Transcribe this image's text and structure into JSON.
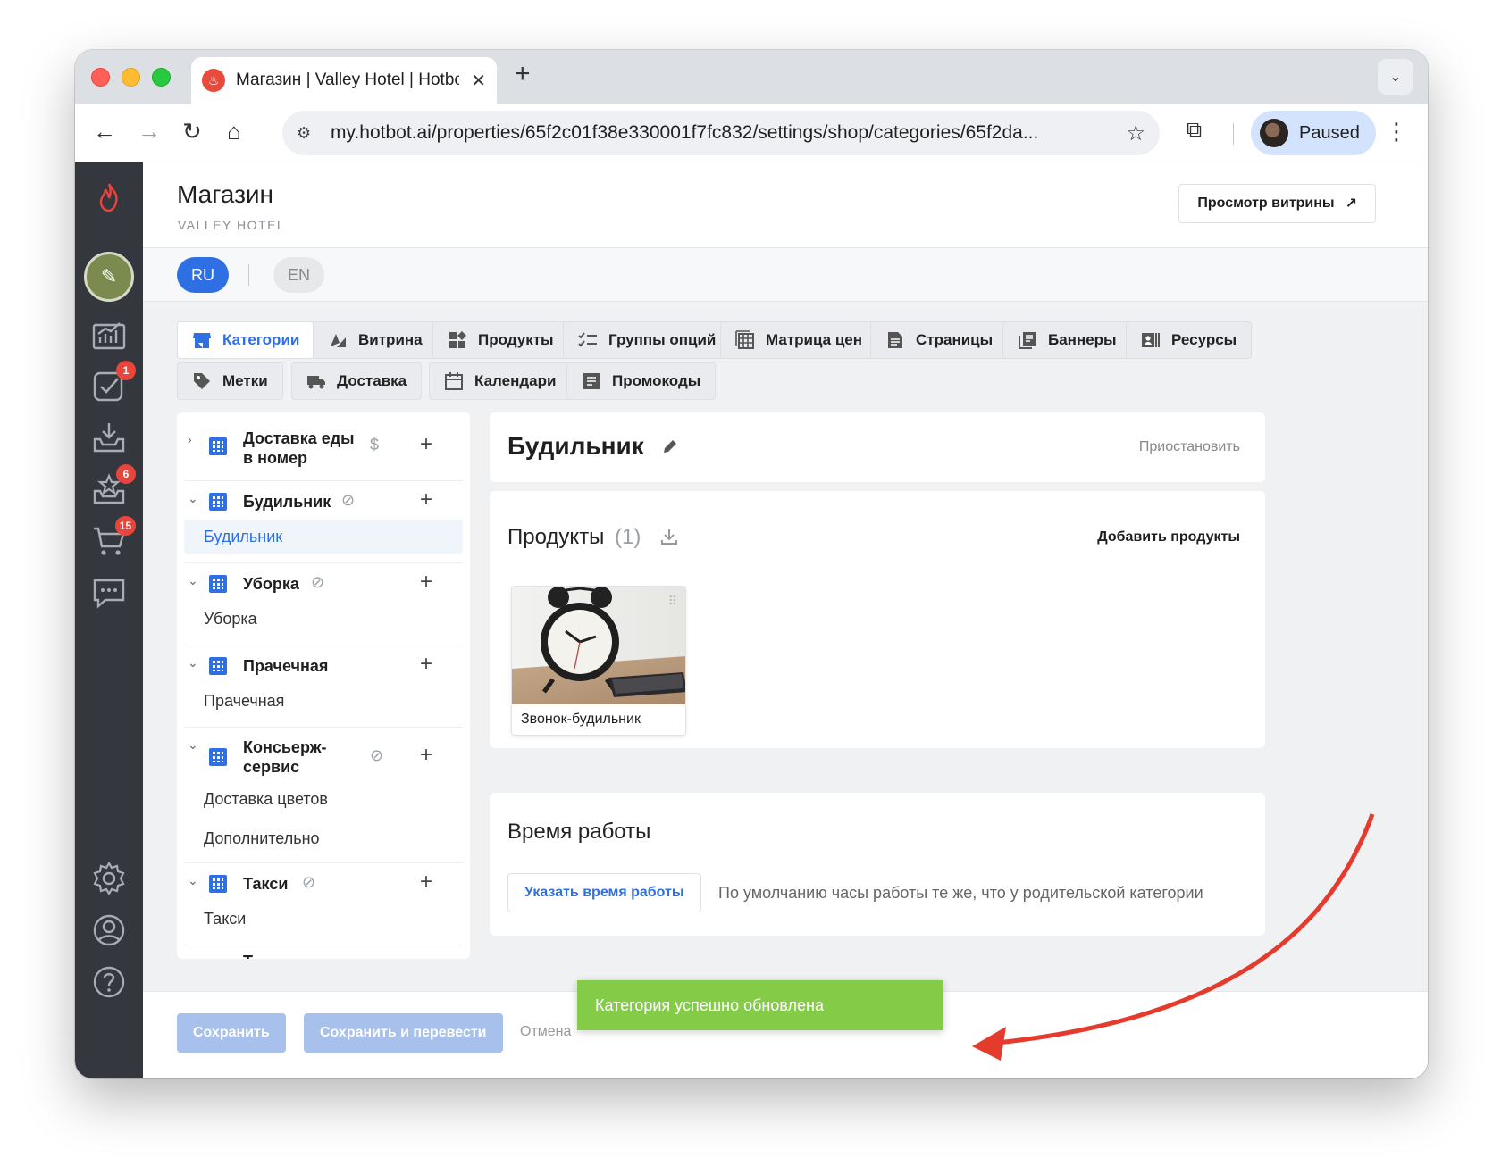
{
  "browser": {
    "tab_title": "Магазин | Valley Hotel | Hotbot",
    "url": "my.hotbot.ai/properties/65f2c01f38e330001f7fc832/settings/shop/categories/65f2da...",
    "profile_label": "Paused"
  },
  "header": {
    "title": "Магазин",
    "subtitle": "VALLEY HOTEL",
    "storefront_button": "Просмотр витрины",
    "storefront_arrow": "↗"
  },
  "languages": {
    "ru": "RU",
    "en": "EN"
  },
  "rail": {
    "badges": {
      "tasks": "1",
      "reviews": "6",
      "orders": "15"
    }
  },
  "tabs": [
    {
      "label": "Категории",
      "icon": "store-icon"
    },
    {
      "label": "Витрина",
      "icon": "shapes-icon"
    },
    {
      "label": "Продукты",
      "icon": "widgets-icon"
    },
    {
      "label": "Группы опций",
      "icon": "checklist-icon"
    },
    {
      "label": "Матрица цен",
      "icon": "grid-icon"
    },
    {
      "label": "Страницы",
      "icon": "document-icon"
    },
    {
      "label": "Баннеры",
      "icon": "library-icon"
    },
    {
      "label": "Ресурсы",
      "icon": "resources-icon"
    },
    {
      "label": "Метки",
      "icon": "tag-icon"
    },
    {
      "label": "Доставка",
      "icon": "truck-icon"
    },
    {
      "label": "Календари",
      "icon": "calendar-icon"
    },
    {
      "label": "Промокоды",
      "icon": "promo-icon"
    }
  ],
  "tree": {
    "categories": [
      {
        "name_line1": "Доставка еды",
        "name_line2": "в номер",
        "flag": "$",
        "children": []
      },
      {
        "name_line1": "Будильник",
        "name_line2": "",
        "flag": "no-cart",
        "children": [
          "Будильник"
        ]
      },
      {
        "name_line1": "Уборка",
        "name_line2": "",
        "flag": "no-cart",
        "children": [
          "Уборка"
        ]
      },
      {
        "name_line1": "Прачечная",
        "name_line2": "",
        "flag": "",
        "children": [
          "Прачечная"
        ]
      },
      {
        "name_line1": "Консьерж-",
        "name_line2": "сервис",
        "flag": "no-cart",
        "children": [
          "Доставка цветов",
          "Дополнительно"
        ]
      },
      {
        "name_line1": "Такси",
        "name_line2": "",
        "flag": "no-cart",
        "children": [
          "Такси"
        ]
      }
    ],
    "partial_row": "Т"
  },
  "category": {
    "title": "Будильник",
    "suspend_label": "Приостановить"
  },
  "products": {
    "label": "Продукты",
    "count": "(1)",
    "add_label": "Добавить продукты",
    "items": [
      {
        "name": "Звонок-будильник"
      }
    ]
  },
  "hours": {
    "label": "Время работы",
    "button": "Указать время работы",
    "hint": "По умолчанию часы работы те же, что у родительской категории"
  },
  "footer": {
    "save": "Сохранить",
    "save_translate": "Сохранить и перевести",
    "cancel": "Отмена"
  },
  "toast": {
    "message": "Категория успешно обновлена"
  },
  "colors": {
    "accent": "#2f6fe4",
    "rail": "#34373d",
    "toast": "#84cc47",
    "badge": "#e8453c",
    "annotation": "#e53b2c"
  }
}
